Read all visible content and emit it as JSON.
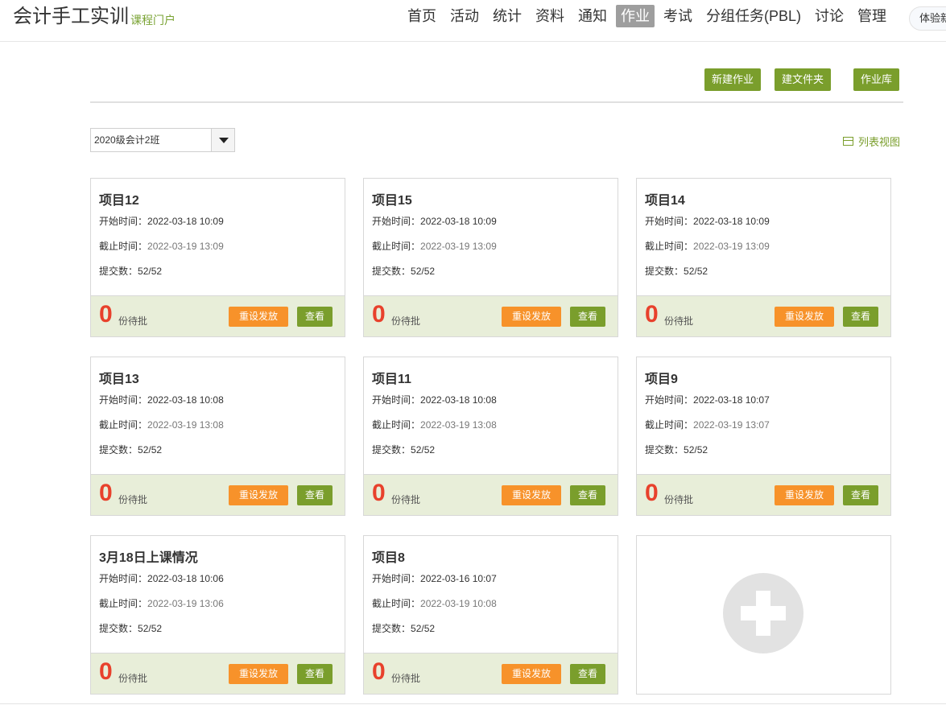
{
  "header": {
    "title": "会计手工实训",
    "subtitle": "课程门户",
    "nav": [
      "首页",
      "活动",
      "统计",
      "资料",
      "通知",
      "作业",
      "考试",
      "分组任务(PBL)",
      "讨论",
      "管理"
    ],
    "active_nav": "作业",
    "user_pill": "体验新版"
  },
  "toolbar": {
    "new_homework": "新建作业",
    "new_folder": "建文件夹",
    "homework_library": "作业库"
  },
  "filter": {
    "class_selected": "2020级会计2班",
    "list_view": "列表视图"
  },
  "labels": {
    "start": "开始时间：",
    "end": "截止时间：",
    "submitted": "提交数：",
    "pending_suffix": "份待批",
    "reset_button": "重设发放",
    "view_button": "查看"
  },
  "cards": [
    {
      "title": "项目12",
      "start": "2022-03-18 10:09",
      "end": "2022-03-19 13:09",
      "submitted": "52/52",
      "pending": "0"
    },
    {
      "title": "项目15",
      "start": "2022-03-18 10:09",
      "end": "2022-03-19 13:09",
      "submitted": "52/52",
      "pending": "0"
    },
    {
      "title": "项目14",
      "start": "2022-03-18 10:09",
      "end": "2022-03-19 13:09",
      "submitted": "52/52",
      "pending": "0"
    },
    {
      "title": "项目13",
      "start": "2022-03-18 10:08",
      "end": "2022-03-19 13:08",
      "submitted": "52/52",
      "pending": "0"
    },
    {
      "title": "项目11",
      "start": "2022-03-18 10:08",
      "end": "2022-03-19 13:08",
      "submitted": "52/52",
      "pending": "0"
    },
    {
      "title": "项目9",
      "start": "2022-03-18 10:07",
      "end": "2022-03-19 13:07",
      "submitted": "52/52",
      "pending": "0"
    },
    {
      "title": "3月18日上课情况",
      "start": "2022-03-18 10:06",
      "end": "2022-03-19 13:06",
      "submitted": "52/52",
      "pending": "0"
    },
    {
      "title": "项目8",
      "start": "2022-03-16 10:07",
      "end": "2022-03-19 10:08",
      "submitted": "52/52",
      "pending": "0"
    }
  ],
  "colors": {
    "accent_green": "#7a9e2c",
    "orange": "#f7922a",
    "count_red": "#e8412c",
    "footer_bg": "#e8eed9"
  }
}
